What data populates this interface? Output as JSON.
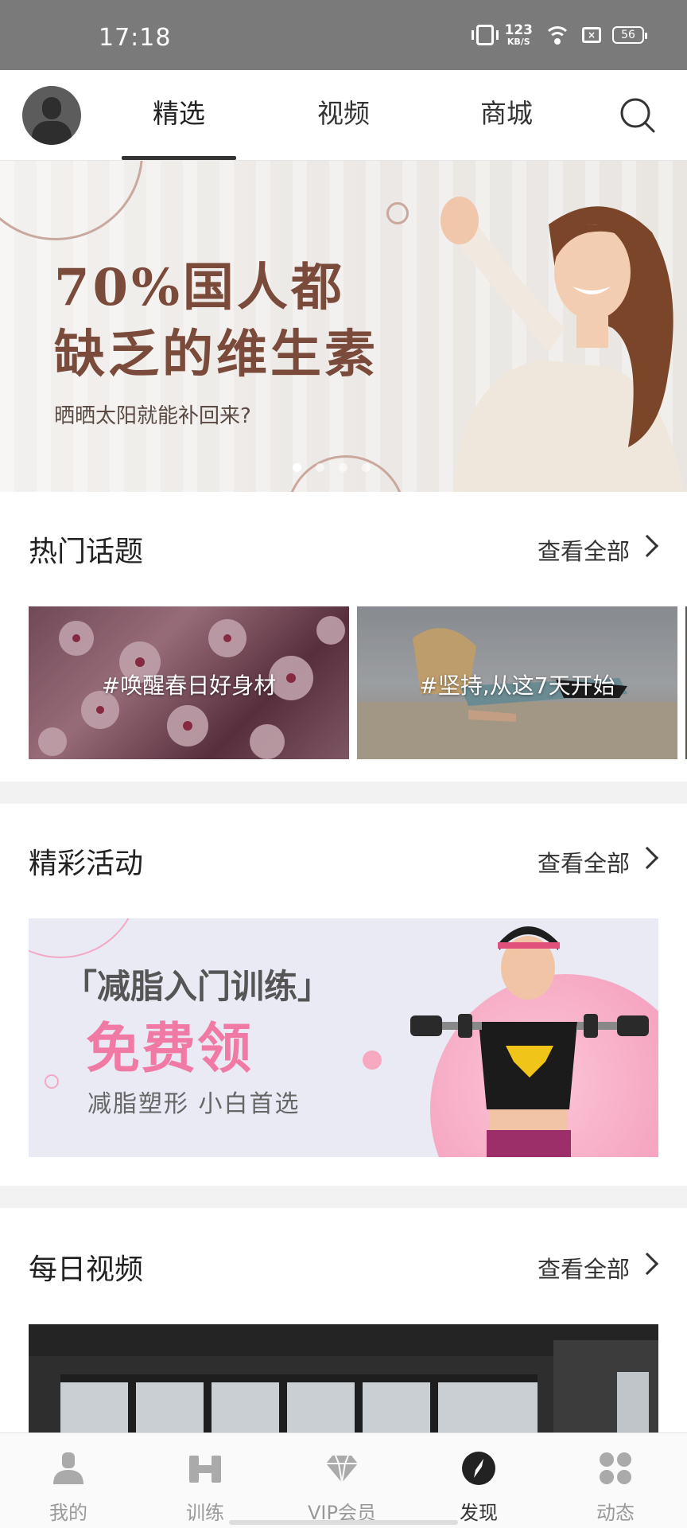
{
  "status_bar": {
    "time": "17:18",
    "speed_value": "123",
    "speed_unit": "KB/S",
    "battery": "56"
  },
  "top_nav": {
    "tabs": [
      {
        "label": "精选",
        "active": true
      },
      {
        "label": "视频",
        "active": false
      },
      {
        "label": "商城",
        "active": false
      }
    ]
  },
  "banner": {
    "title_line1": "70%国人都",
    "title_line2": "缺乏的维生素",
    "subtitle": "晒晒太阳就能补回来?",
    "dots_count": 4,
    "active_dot": 0
  },
  "hot_topics": {
    "title": "热门话题",
    "more": "查看全部",
    "items": [
      {
        "label": "#唤醒春日好身材"
      },
      {
        "label": "#坚持,从这7天开始"
      }
    ]
  },
  "activities": {
    "title": "精彩活动",
    "more": "查看全部",
    "banner": {
      "title": "「减脂入门训练」",
      "highlight": "免费领",
      "subtitle": "减脂塑形  小白首选"
    }
  },
  "daily_video": {
    "title": "每日视频",
    "more": "查看全部"
  },
  "bottom_nav": {
    "items": [
      {
        "label": "我的",
        "icon": "person-icon",
        "active": false
      },
      {
        "label": "训练",
        "icon": "dumbbell-icon",
        "active": false
      },
      {
        "label": "VIP会员",
        "icon": "diamond-icon",
        "active": false
      },
      {
        "label": "发现",
        "icon": "compass-icon",
        "active": true
      },
      {
        "label": "动态",
        "icon": "apps-icon",
        "active": false
      }
    ]
  },
  "colors": {
    "banner_title": "#7a4a3a",
    "activity_pink": "#f07aa4",
    "status_bar_bg": "#7a7a7a"
  }
}
